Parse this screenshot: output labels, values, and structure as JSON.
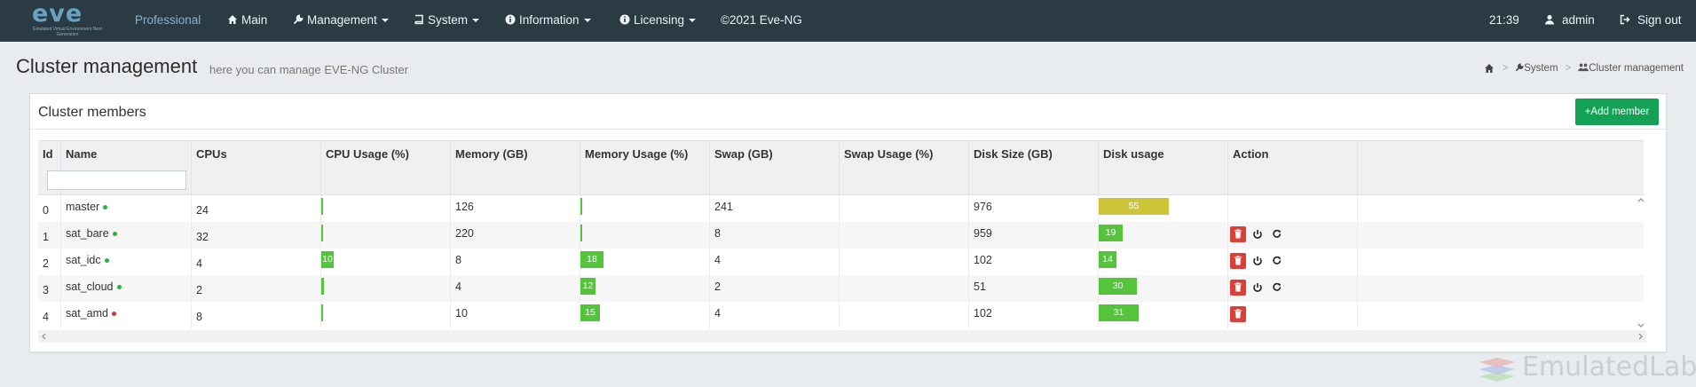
{
  "navbar": {
    "brand_logo": "eve",
    "brand_sub": "Emulated Virtual Environment Next Generation",
    "items": [
      {
        "label": "Professional",
        "icon": "",
        "caret": false
      },
      {
        "label": "Main",
        "icon": "home-icon",
        "caret": false
      },
      {
        "label": "Management",
        "icon": "wrench-icon",
        "caret": true
      },
      {
        "label": "System",
        "icon": "book-icon",
        "caret": true
      },
      {
        "label": "Information",
        "icon": "info-icon",
        "caret": true
      },
      {
        "label": "Licensing",
        "icon": "info-icon",
        "caret": true
      },
      {
        "label": "©2021 Eve-NG",
        "icon": "",
        "caret": false
      }
    ],
    "time": "21:39",
    "user": "admin",
    "signout": "Sign out"
  },
  "page": {
    "title": "Cluster management",
    "subtitle": "here you can manage EVE-NG Cluster",
    "breadcrumb": [
      "System",
      "Cluster management"
    ]
  },
  "panel": {
    "title": "Cluster members",
    "add_label": "+Add member"
  },
  "table": {
    "columns": [
      "Id",
      "Name",
      "CPUs",
      "CPU Usage (%)",
      "Memory (GB)",
      "Memory Usage (%)",
      "Swap (GB)",
      "Swap Usage (%)",
      "Disk Size (GB)",
      "Disk usage",
      "Action"
    ],
    "rows": [
      {
        "id": "0",
        "name": "master",
        "status": "online",
        "cpus": "24",
        "cpu_usage": 1,
        "cpu_label": "",
        "memory": "126",
        "mem_usage": 1,
        "mem_label": "",
        "swap": "241",
        "swap_usage": 0,
        "disk": "976",
        "disk_usage": 55,
        "disk_label": "55",
        "actions": []
      },
      {
        "id": "1",
        "name": "sat_bare",
        "status": "online",
        "cpus": "32",
        "cpu_usage": 1,
        "cpu_label": "",
        "memory": "220",
        "mem_usage": 1,
        "mem_label": "",
        "swap": "8",
        "swap_usage": 0,
        "disk": "959",
        "disk_usage": 19,
        "disk_label": "19",
        "actions": [
          "delete",
          "power",
          "refresh"
        ]
      },
      {
        "id": "2",
        "name": "sat_idc",
        "status": "online",
        "cpus": "4",
        "cpu_usage": 10,
        "cpu_label": "10",
        "memory": "8",
        "mem_usage": 18,
        "mem_label": "18",
        "swap": "4",
        "swap_usage": 0,
        "disk": "102",
        "disk_usage": 14,
        "disk_label": "14",
        "actions": [
          "delete",
          "power",
          "refresh"
        ]
      },
      {
        "id": "3",
        "name": "sat_cloud",
        "status": "online",
        "cpus": "2",
        "cpu_usage": 2,
        "cpu_label": "",
        "memory": "4",
        "mem_usage": 12,
        "mem_label": "12",
        "swap": "2",
        "swap_usage": 0,
        "disk": "51",
        "disk_usage": 30,
        "disk_label": "30",
        "actions": [
          "delete",
          "power",
          "refresh"
        ]
      },
      {
        "id": "4",
        "name": "sat_amd",
        "status": "offline",
        "cpus": "8",
        "cpu_usage": 1,
        "cpu_label": "",
        "memory": "10",
        "mem_usage": 15,
        "mem_label": "15",
        "swap": "4",
        "swap_usage": 0,
        "disk": "102",
        "disk_usage": 31,
        "disk_label": "31",
        "actions": [
          "delete"
        ]
      }
    ]
  },
  "colors": {
    "navbar": "#2a3b44",
    "bar_green": "#54c43a",
    "bar_yellow": "#cfc53a",
    "online": "#27b341",
    "offline": "#d9343a",
    "delete": "#d9403a",
    "add_button": "#13a156"
  },
  "watermark": "EmulatedLab"
}
